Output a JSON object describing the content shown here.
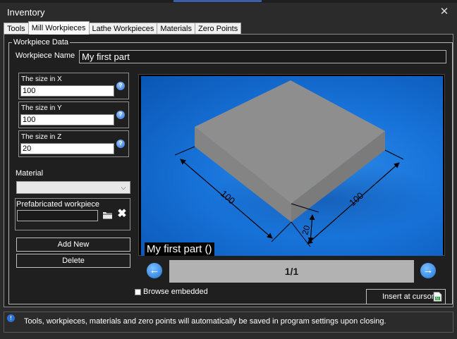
{
  "window": {
    "title": "Inventory",
    "close_glyph": "✕"
  },
  "tabs": [
    {
      "label": "Tools",
      "active": false
    },
    {
      "label": "Mill Workpieces",
      "active": true
    },
    {
      "label": "Lathe Workpieces",
      "active": false
    },
    {
      "label": "Materials",
      "active": false
    },
    {
      "label": "Zero Points",
      "active": false
    }
  ],
  "workpiece": {
    "group_title": "Workpiece Data",
    "name_label": "Workpiece Name",
    "name_value": "My first part",
    "size_x": {
      "label": "The size in X",
      "value": "100"
    },
    "size_y": {
      "label": "The size in Y",
      "value": "100"
    },
    "size_z": {
      "label": "The size in Z",
      "value": "20"
    },
    "material_label": "Material",
    "material_value": "",
    "prefab_label": "Prefabricated workpiece",
    "prefab_value": "",
    "add_new_label": "Add New",
    "delete_label": "Delete"
  },
  "preview": {
    "caption": "My first part ()",
    "dim_left": "100",
    "dim_right": "100",
    "dim_height": "20",
    "pager": "1/1",
    "prev_glyph": "🡐",
    "next_glyph": "🡒"
  },
  "browse_embedded": {
    "label": "Browse embedded",
    "checked": false
  },
  "insert_label": "Insert at cursor",
  "info": {
    "text": "Tools, workpieces, materials and zero points will automatically be saved in program settings upon closing."
  },
  "colors": {
    "preview_bg": "#1874da",
    "box_gray": "#8e8e8e",
    "accent_blue": "#2d6fd8"
  },
  "icons": {
    "help": "help-icon",
    "folder": "folder-icon",
    "clear": "x-icon",
    "insert": "insert-document-icon",
    "info": "info-icon"
  }
}
